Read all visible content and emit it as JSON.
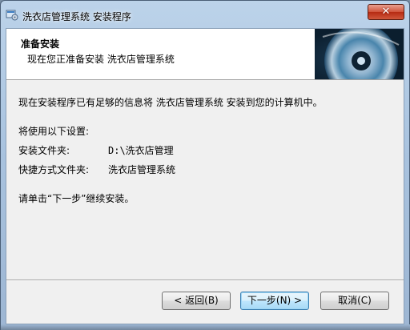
{
  "window": {
    "title": "洗衣店管理系统 安装程序",
    "close_glyph": "✕"
  },
  "header": {
    "title": "准备安装",
    "subtitle": "现在您正准备安装 洗衣店管理系统"
  },
  "body": {
    "intro": "现在安装程序已有足够的信息将 洗衣店管理系统 安装到您的计算机中。",
    "settings_heading": "将使用以下设置:",
    "install_folder_label": "安装文件夹:",
    "install_folder_value": "D:\\洗衣店管理",
    "shortcut_folder_label": "快捷方式文件夹:",
    "shortcut_folder_value": "洗衣店管理系统",
    "next_instruction": "请单击“下一步”继续安装。"
  },
  "buttons": {
    "back": "< 返回(B)",
    "next": "下一步(N) >",
    "cancel": "取消(C)"
  },
  "icons": {
    "app": "installer-app-icon",
    "header_graphic": "cd-disc-graphic"
  }
}
